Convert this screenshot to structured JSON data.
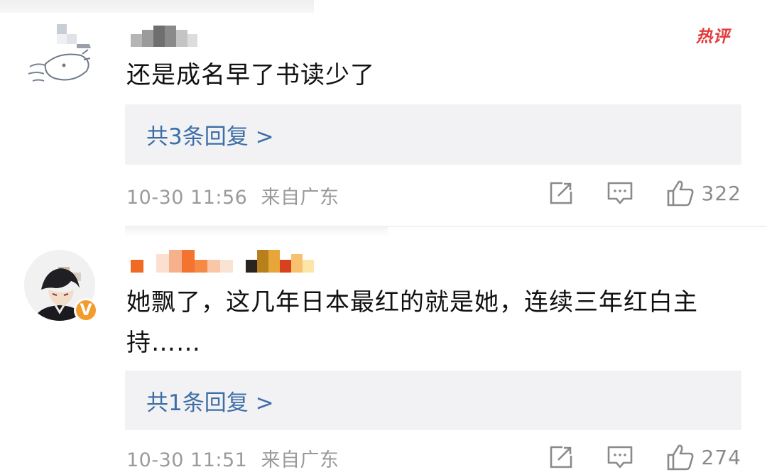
{
  "comments": [
    {
      "content": "还是成名早了书读少了",
      "hot_badge": "热评",
      "reply_label": "共3条回复 >",
      "timestamp": "10-30 11:56",
      "location": "来自广东",
      "like_count": "322"
    },
    {
      "content": "她飘了，这几年日本最红的就是她，连续三年红白主持……",
      "reply_label": "共1条回复 >",
      "timestamp": "10-30 11:51",
      "location": "来自广东",
      "like_count": "274",
      "verified": true
    }
  ],
  "icons": {
    "share": "share-icon",
    "comment": "comment-icon",
    "like": "thumbs-up-icon",
    "verified": "verified-v-icon"
  },
  "colors": {
    "reply_link": "#3d6fa6",
    "hot_badge": "#e33a3a",
    "verified_badge": "#f39b2b",
    "meta_text": "#9a9a9a",
    "reply_box_bg": "#f2f2f4"
  }
}
